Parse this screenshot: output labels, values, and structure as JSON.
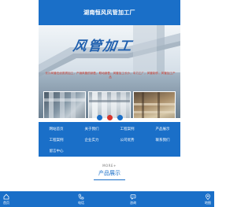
{
  "header": {
    "title": "湖南恒风风管加工厂"
  },
  "banner": {
    "brand": "风管加工",
    "description": "长沙风管在优质质加工，产销风管的销售，联动销售，风管加工长沙，中力工厂，风管制作，风管加工产品"
  },
  "carousel": {
    "dots": [
      "#1a6fc8",
      "#d9342b",
      "#1a6fc8"
    ]
  },
  "nav": {
    "items": [
      {
        "label": "网站首页"
      },
      {
        "label": "关于我们"
      },
      {
        "label": "工程案例"
      },
      {
        "label": "产品展示"
      },
      {
        "label": "工程案例"
      },
      {
        "label": "企业实力"
      },
      {
        "label": "公司优势"
      },
      {
        "label": "联系我们"
      },
      {
        "label": "留言中心"
      }
    ]
  },
  "section": {
    "en": "MORE+",
    "cn": "产品展示"
  },
  "tabbar": {
    "items": [
      {
        "label": "首页",
        "icon": "home-icon"
      },
      {
        "label": "电话",
        "icon": "phone-icon"
      },
      {
        "label": "咨询",
        "icon": "chat-icon"
      },
      {
        "label": "地图",
        "icon": "map-pin-icon"
      }
    ]
  },
  "colors": {
    "primary": "#1a6fc8",
    "accent": "#d9342b"
  }
}
